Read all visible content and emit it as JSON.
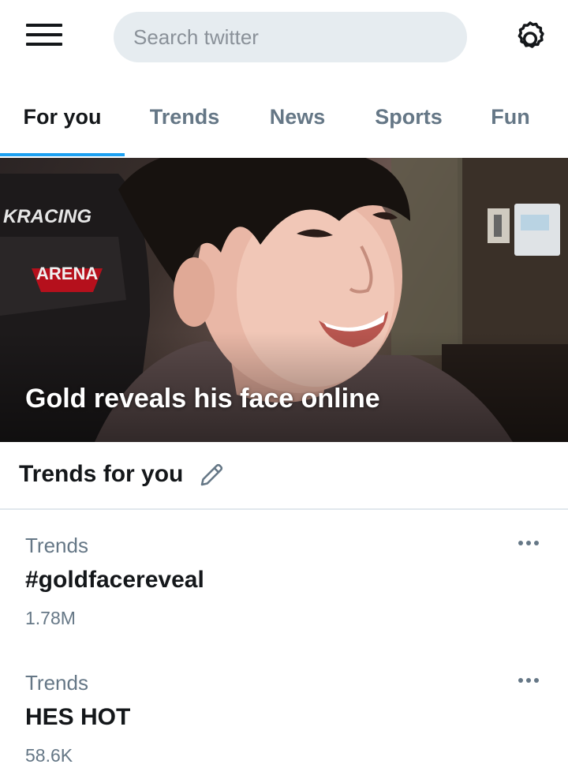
{
  "header": {
    "menu_icon": "hamburger-menu-icon",
    "search_placeholder": "Search twitter",
    "search_value": "",
    "settings_icon": "gear-icon"
  },
  "tabs": [
    {
      "label": "For you",
      "active": true
    },
    {
      "label": "Trends",
      "active": false
    },
    {
      "label": "News",
      "active": false
    },
    {
      "label": "Sports",
      "active": false
    },
    {
      "label": "Fun",
      "active": false
    }
  ],
  "hero": {
    "headline": "Gold reveals his face online",
    "chair_brand_top": "KRACING",
    "chair_brand_bottom": "ARENA"
  },
  "trends_section": {
    "title": "Trends for you",
    "edit_icon": "pencil-icon"
  },
  "trends": [
    {
      "category": "Trends",
      "name": "#goldfacereveal",
      "count": "1.78M"
    },
    {
      "category": "Trends",
      "name": "HES HOT",
      "count": "58.6K"
    }
  ],
  "colors": {
    "accent": "#1da1f2",
    "text_primary": "#14171a",
    "text_secondary": "#657786",
    "search_bg": "#e6ecf0"
  }
}
